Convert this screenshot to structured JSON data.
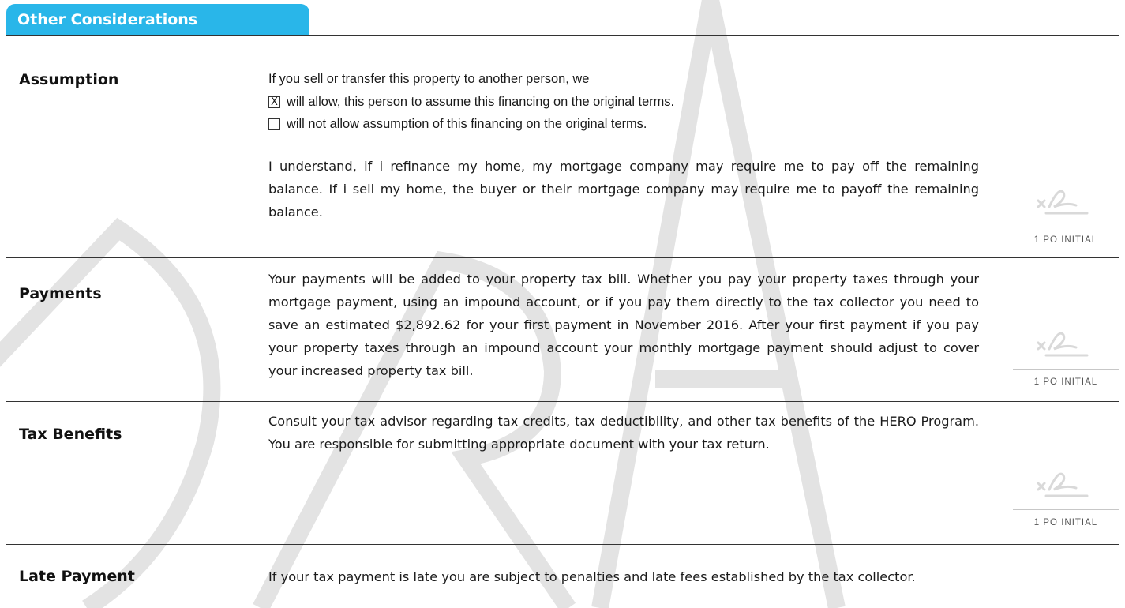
{
  "section": {
    "title": "Other Considerations"
  },
  "assumption": {
    "label": "Assumption",
    "intro": "If you sell or transfer this property to another person, we",
    "options": [
      {
        "mark": "X",
        "text": "will allow, this person to assume this financing on the original terms."
      },
      {
        "mark": "",
        "text": "will not allow assumption of this financing on the original terms."
      }
    ],
    "body": "I understand, if i refinance my home, my mortgage company may require me to pay off the remaining balance. If i sell my home, the buyer or their mortgage company may require me to payoff the remaining balance.",
    "initial_caption": "1 PO INITIAL"
  },
  "payments": {
    "label": "Payments",
    "body": "Your payments will be added to your property tax bill.  Whether you pay your property taxes through your mortgage payment, using an impound account, or if you pay them directly to the tax collector you need to save an estimated $2,892.62 for your first payment in November 2016. After your first payment if you pay your property taxes through an impound account your monthly mortgage payment should adjust to cover your increased property tax bill.",
    "initial_caption": "1 PO INITIAL"
  },
  "tax_benefits": {
    "label": "Tax Benefits",
    "body": "Consult your tax advisor regarding tax credits, tax deductibility, and other tax benefits of the HERO Program. You are responsible for submitting appropriate document with your tax return.",
    "initial_caption": "1 PO INITIAL"
  },
  "late_payment": {
    "label": "Late Payment",
    "body": "If your tax payment is late you are subject to penalties and late fees established by the tax collector."
  },
  "watermark": {
    "text": "DRAFT",
    "color": "#e6e6e6"
  },
  "colors": {
    "accent": "#29b6e9",
    "rule": "#333333",
    "initial_line": "#c7c7c7"
  }
}
